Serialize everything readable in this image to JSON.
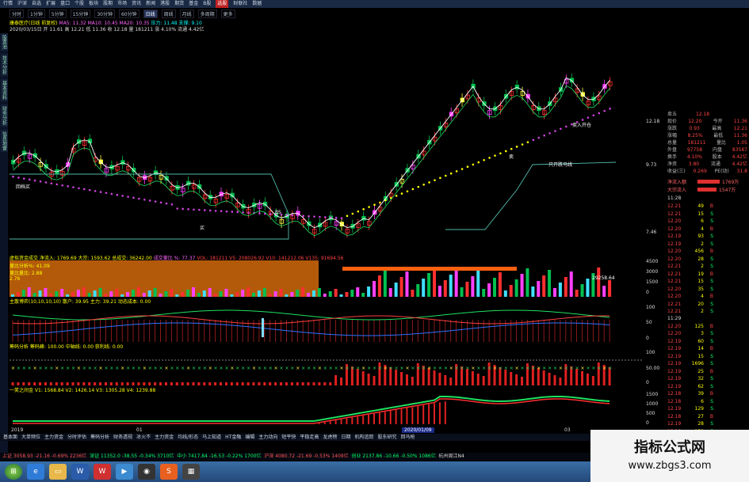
{
  "menubar": [
    "行情",
    "沪深",
    "自选",
    "扩展",
    "盘口",
    "个股",
    "板块",
    "股期",
    "市场",
    "资讯",
    "新闻",
    "港股",
    "期货",
    "基金",
    "B股",
    "选股",
    "财联社",
    "数据"
  ],
  "menu_highlight": "选股",
  "timeframes": [
    "分时",
    "1分钟",
    "5分钟",
    "15分钟",
    "30分钟",
    "60分钟",
    "日线",
    "周线",
    "月线",
    "多周期",
    "更多"
  ],
  "timeframe_active": "日线",
  "main_info": {
    "line1": "康泰医疗(日线 前复权)",
    "line1b": "MA5: 11.32  MA10: 10.45  MA20: 10.35",
    "line1c": "压力: 11.48  支撑: 9.10",
    "line2": "2020/03/15日  开 11.61  高 12.21  低 11.36  收 12.18  量 181211",
    "line2b": "涨 4.10%  流通 4.42亿"
  },
  "price_axis": [
    "12.18",
    "9.73",
    "7.46"
  ],
  "pane_labels": {
    "p1": "虚拟资金成交  净流入: 1769.69  大宗: 1593.62  总成交: 36242.00",
    "p1b": "成交量比 %: 77.37",
    "p1c": "VOL: 181211  V5: 208026.92  V10: 141212.06  V135: 91694.56",
    "p2": "主散博弈(10,10,10,10)  散户: 39.95  主力: 39.21  动态成本: 0.00",
    "p3": "筹码分析  筹码峰: 100.00  中轴线: 0.00  获利线: 0.00",
    "p4": "一笑之间金  V1: 1568.84  V2: 1426.14  V3: 1305.28  V4: 1239.88"
  },
  "vol_axis": [
    "4500",
    "3000",
    "1500",
    "0"
  ],
  "osc_axis": [
    "100",
    "50",
    "0"
  ],
  "osc2_axis": [
    "100",
    "50.00",
    "0"
  ],
  "macd_axis": [
    "1500",
    "1000",
    "500",
    "0"
  ],
  "chart_legend": {
    "left1": "量比分析%: 41.09",
    "left2": "量比量比: 2.88",
    "left3": "2.76"
  },
  "annotations": [
    "回档买",
    "BS",
    "买",
    "卖",
    "只开跌马线",
    "卖入开仓"
  ],
  "vol_annotation": "29258.64",
  "date_axis": [
    "2019",
    "01",
    "2020/01/09",
    "03"
  ],
  "rpanel": {
    "quote": [
      {
        "l": "卖五",
        "v": "12.18"
      },
      {
        "l": "现价",
        "v": "12.20",
        "l2": "今开",
        "v2": "11.36"
      },
      {
        "l": "涨跌",
        "v": "0.93",
        "l2": "最高",
        "v2": "12.21"
      },
      {
        "l": "涨幅",
        "v": "8.25%",
        "l2": "最低",
        "v2": "11.36"
      },
      {
        "l": "总量",
        "v": "181211",
        "l2": "量比",
        "v2": "1.05"
      },
      {
        "l": "外盘",
        "v": "97758",
        "l2": "内盘",
        "v2": "83587"
      },
      {
        "l": "换手",
        "v": "4.10%",
        "l2": "股本",
        "v2": "4.42亿"
      },
      {
        "l": "净资",
        "v": "3.80",
        "l2": "流通",
        "v2": "4.42亿"
      },
      {
        "l": "收益(三)",
        "v": "0.269",
        "l2": "PE(动)",
        "v2": "31.8"
      }
    ],
    "flow": [
      {
        "l": "净流入额",
        "v": "1769万"
      },
      {
        "l": "大宗流入",
        "v": "1547万"
      }
    ],
    "time_label": "11:28",
    "ticks": [
      [
        "12.21",
        "49"
      ],
      [
        "12.21",
        "15"
      ],
      [
        "12.20",
        "6"
      ],
      [
        "12.20",
        "4"
      ],
      [
        "12.19",
        "93"
      ],
      [
        "12.19",
        "2"
      ],
      [
        "12.20",
        "456"
      ],
      [
        "12.20",
        "28"
      ],
      [
        "12.21",
        "2"
      ],
      [
        "12.21",
        "19"
      ],
      [
        "12.21",
        "15"
      ],
      [
        "12.20",
        "35"
      ],
      [
        "12.20",
        "4"
      ],
      [
        "12.21",
        "20"
      ],
      [
        "12.21",
        "2"
      ],
      [
        "12.20",
        "125"
      ],
      [
        "12.20",
        "3"
      ],
      [
        "12.19",
        "60"
      ],
      [
        "12.19",
        "14"
      ],
      [
        "12.19",
        "15"
      ],
      [
        "12.19",
        "1696"
      ],
      [
        "12.19",
        "25"
      ],
      [
        "12.19",
        "32"
      ],
      [
        "12.19",
        "62"
      ],
      [
        "12.18",
        "39"
      ],
      [
        "12.18",
        "6"
      ],
      [
        "12.19",
        "129"
      ],
      [
        "12.18",
        "27"
      ],
      [
        "12.19",
        "28"
      ],
      [
        "12.18",
        "150"
      ],
      [
        "12.18",
        "54"
      ],
      [
        "12.18",
        "15"
      ]
    ],
    "time_label2": "11:29"
  },
  "botbar": [
    "基本面",
    "大单频位",
    "主力资金",
    "分时评估",
    "筹码分析",
    "财务透视",
    "冰火不",
    "主力资金",
    "均线/形态",
    "马上知道",
    "HT金融",
    "编辑",
    "主力动向",
    "短平快",
    "平稳走高",
    "龙虎榜",
    "日期",
    "机构追踪",
    "股东研究",
    "回马枪"
  ],
  "status": {
    "a": "上证 3058.93  -21.16  -0.69%  2236亿",
    "b": "深证 11352.0  -38.55  -0.34%  3710亿",
    "c": "中小 7417.84  -16.53  -0.22%  1700亿",
    "d": "沪深 4080.72  -21.69  -0.53%  1409亿",
    "e": "创业 2137.86  -10.66  -0.50%  1086亿",
    "f": "杭州周江N4"
  },
  "taskbar_icons": [
    "start-orb",
    "ie",
    "folder",
    "word",
    "wps",
    "media",
    "qq",
    "sogou",
    "app"
  ],
  "watermark": {
    "title": "指标公式网",
    "url": "www.zbgs3.com"
  },
  "colors": {
    "up": "#ff3030",
    "down": "#00d060",
    "ma_white": "#ffffff",
    "dot_magenta": "#e040e0",
    "dot_yellow": "#ffff00",
    "cyan_line": "#4fb8a8"
  }
}
